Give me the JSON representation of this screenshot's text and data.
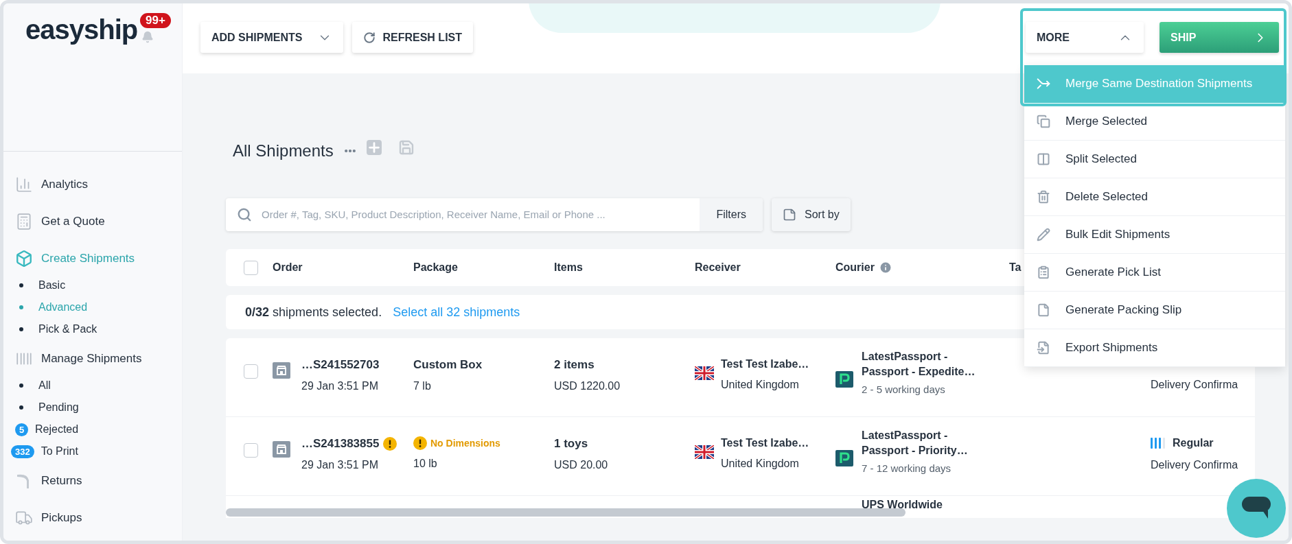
{
  "logo": {
    "text": "easyship",
    "notification_count": "99+"
  },
  "sidebar": {
    "items": [
      {
        "label": "Analytics",
        "selected": false
      },
      {
        "label": "Get a Quote",
        "selected": false
      },
      {
        "label": "Create Shipments",
        "selected": true,
        "children": [
          {
            "label": "Basic",
            "selected": false
          },
          {
            "label": "Advanced",
            "selected": true
          },
          {
            "label": "Pick & Pack",
            "selected": false
          }
        ]
      },
      {
        "label": "Manage Shipments",
        "selected": false,
        "children": [
          {
            "label": "All",
            "selected": false
          },
          {
            "label": "Pending",
            "selected": false
          },
          {
            "label": "Rejected",
            "selected": false,
            "badge": "5"
          },
          {
            "label": "To Print",
            "selected": false,
            "badge": "332"
          }
        ]
      },
      {
        "label": "Returns",
        "selected": false
      },
      {
        "label": "Pickups",
        "selected": false
      }
    ]
  },
  "toolbar": {
    "buttons": [
      {
        "label": "ADD SHIPMENTS",
        "kind": "dropdown"
      },
      {
        "label": "REFRESH LIST",
        "kind": "refresh"
      }
    ]
  },
  "actions": {
    "more": {
      "label": "MORE",
      "expanded": true
    },
    "ship": {
      "label": "SHIP"
    }
  },
  "menu": {
    "items": [
      {
        "label": "Merge Same Destination Shipments",
        "selected": true
      },
      {
        "label": "Merge Selected",
        "selected": false
      },
      {
        "label": "Split Selected",
        "selected": false
      },
      {
        "label": "Delete Selected",
        "selected": false
      },
      {
        "label": "Bulk Edit Shipments",
        "selected": false
      },
      {
        "label": "Generate Pick List",
        "selected": false
      },
      {
        "label": "Generate Packing Slip",
        "selected": false
      },
      {
        "label": "Export Shipments",
        "selected": false
      }
    ]
  },
  "page_title": "All Shipments",
  "search": {
    "placeholder": "Order #, Tag, SKU, Product Description, Receiver Name, Email or Phone ...",
    "filters": "Filters",
    "sort": "Sort by"
  },
  "table": {
    "columns": [
      {
        "label": "Order",
        "info": false
      },
      {
        "label": "Package",
        "info": false
      },
      {
        "label": "Items",
        "info": false
      },
      {
        "label": "Receiver",
        "info": false
      },
      {
        "label": "Courier",
        "info": true
      },
      {
        "label": "Ta",
        "info": false
      }
    ],
    "all_checked": false,
    "selection": {
      "text": "**0/32** shipments selected.",
      "link": "Select all 32 shipments"
    },
    "rows": [
      {
        "checked": false,
        "order": "…S241552703",
        "order_warning": false,
        "date": "29 Jan 3:51 PM",
        "package": "Custom Box",
        "package_warning": false,
        "weight": "7 lb",
        "items": "2 items",
        "value": "USD 1220.00",
        "receiver": "Test Test Izabe…",
        "country": "United Kingdom",
        "courier_logo": true,
        "courier": "LatestPassport - Passport - Expedite…",
        "delivery": "2 - 5 working days",
        "service": "Delivery Confirma"
      },
      {
        "checked": false,
        "order": "…S241383855",
        "order_warning": true,
        "date": "29 Jan 3:51 PM",
        "package": "No Dimensions",
        "package_warning": true,
        "weight": "10 lb",
        "items": "1 toys",
        "value": "USD 20.00",
        "receiver": "Test Test Izabe…",
        "country": "United Kingdom",
        "courier_logo": true,
        "courier": "LatestPassport - Passport - Priority…",
        "delivery": "7 - 12 working days",
        "rating": "Regular",
        "service": "Delivery Confirma"
      },
      {
        "courier_logo": false,
        "courier": "UPS Worldwide"
      }
    ]
  }
}
